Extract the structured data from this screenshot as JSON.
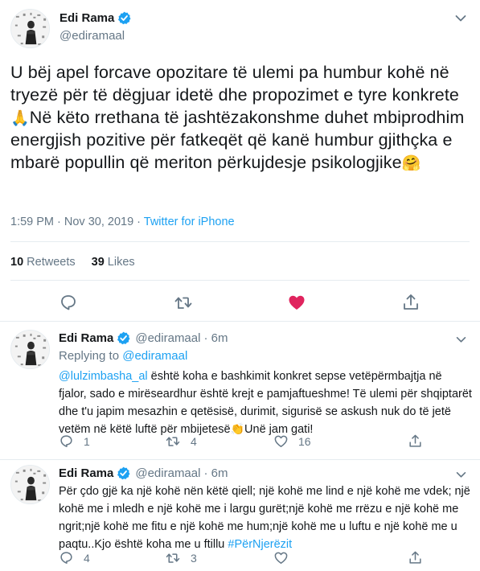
{
  "main_tweet": {
    "author_name": "Edi Rama",
    "author_handle": "@ediramaal",
    "text_part1": "U bëj apel forcave opozitare të ulemi pa humbur kohë në tryezë për të dëgjuar idetë dhe propozimet e tyre konkrete",
    "emoji1": "🙏",
    "text_part2": "Në këto rrethana të jashtëzakonshme duhet mbiprodhim energjish pozitive për fatkeqët që kanë humbur gjithçka e mbarë popullin që meriton përkujdesje psikologjike",
    "emoji2": "🤗",
    "time": "1:59 PM · Nov 30, 2019 · ",
    "source": "Twitter for iPhone",
    "retweets_count": "10",
    "retweets_label": "Retweets",
    "likes_count": "39",
    "likes_label": "Likes",
    "like_color": "#e0245e",
    "icon_color": "#657786"
  },
  "replies": [
    {
      "author_name": "Edi Rama",
      "author_handle": "@ediramaal",
      "time": "· 6m",
      "replying_prefix": "Replying to ",
      "replying_to": "@ediramaal",
      "mention": "@lulzimbasha_al",
      "text": " është koha e bashkimit konkret sepse vetëpërmbajtja në fjalor, sado e mirëseardhur është krejt e pamjaftueshme! Të ulemi për shqiptarët dhe t'u japim mesazhin e qetësisë, durimit, sigurisë se askush nuk do të jetë vetëm në këtë luftë për mbijetesë",
      "emoji": "👏",
      "text_end": "Unë jam gati!",
      "reply_count": "1",
      "retweet_count": "4",
      "like_count": "16"
    },
    {
      "author_name": "Edi Rama",
      "author_handle": "@ediramaal",
      "time": "· 6m",
      "text": "Për çdo gjë ka një kohë nën këtë qiell; një kohë me lind e një kohë me vdek; një kohë me i mledh e një kohë me i largu gurët;një kohë me rrëzu e një kohë me ngrit;një kohë me fitu e një kohë me hum;një kohë me u luftu e një kohë me u paqtu..Kjo është koha me u ftillu ",
      "hashtag": "#PërNjerëzit",
      "reply_count": "4",
      "retweet_count": "3",
      "like_count": ""
    }
  ]
}
